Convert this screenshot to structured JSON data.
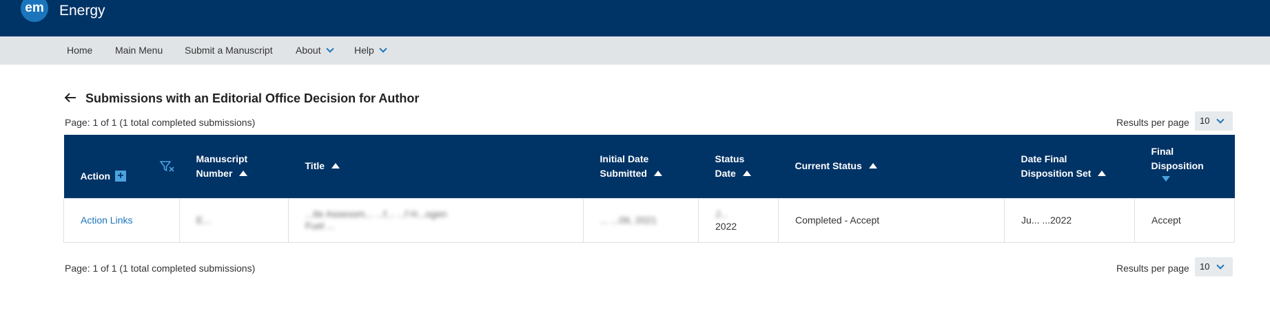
{
  "header": {
    "logo_text": "em",
    "app_name": "Energy"
  },
  "nav": {
    "items": [
      {
        "label": "Home",
        "dropdown": false
      },
      {
        "label": "Main Menu",
        "dropdown": false
      },
      {
        "label": "Submit a Manuscript",
        "dropdown": false
      },
      {
        "label": "About",
        "dropdown": true
      },
      {
        "label": "Help",
        "dropdown": true
      }
    ]
  },
  "page": {
    "title": "Submissions with an Editorial Office Decision for Author",
    "pager_text": "Page: 1 of 1 (1 total completed submissions)",
    "results_per_page_label": "Results per page",
    "results_per_page_value": "10"
  },
  "table": {
    "columns": [
      {
        "label_line1": "Action",
        "label_line2": ""
      },
      {
        "label_line1": "Manuscript",
        "label_line2": "Number"
      },
      {
        "label_line1": "Title",
        "label_line2": ""
      },
      {
        "label_line1": "Initial Date",
        "label_line2": "Submitted"
      },
      {
        "label_line1": "Status",
        "label_line2": "Date"
      },
      {
        "label_line1": "Current Status",
        "label_line2": ""
      },
      {
        "label_line1": "Date Final",
        "label_line2": "Disposition Set"
      },
      {
        "label_line1": "Final",
        "label_line2": "Disposition"
      }
    ],
    "rows": [
      {
        "action": "Action Links",
        "manuscript_number": "E...",
        "title_line1": "...tle Assessm...                    ...f...   ...f H...ogen",
        "title_line2": "Fuel ...",
        "initial_date": "...  ...09, 2021",
        "status_date_line1": "J...",
        "status_date_line2": "2022",
        "current_status": "Completed - Accept",
        "date_final": "Ju... ...2022",
        "final_disposition": "Accept"
      }
    ]
  },
  "colors": {
    "header_bg": "#003366",
    "nav_bg": "#e1e4e7",
    "link": "#1b75bc",
    "accent": "#4aa3df"
  }
}
